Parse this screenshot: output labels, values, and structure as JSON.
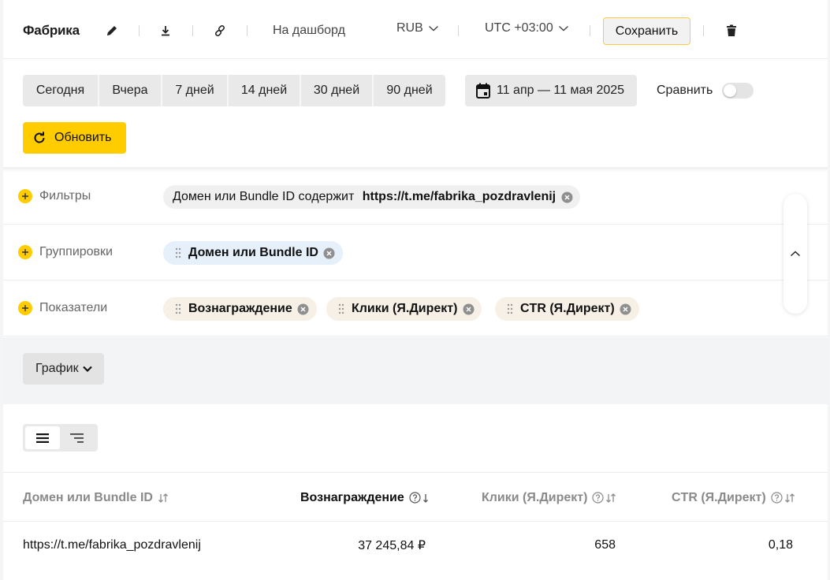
{
  "header": {
    "title": "Фабрика",
    "dashboard_link": "На дашборд",
    "currency": "RUB",
    "timezone": "UTC +03:00",
    "save_label": "Сохранить"
  },
  "periods": [
    "Сегодня",
    "Вчера",
    "7 дней",
    "14 дней",
    "30 дней",
    "90 дней"
  ],
  "date_range": "11 апр — 11 мая 2025",
  "compare_label": "Сравнить",
  "compare_enabled": false,
  "refresh_label": "Обновить",
  "filters": {
    "label": "Фильтры",
    "chip_prefix": "Домен или Bundle ID содержит ",
    "chip_value": "https://t.me/fabrika_pozdravlenij"
  },
  "groupings": {
    "label": "Группировки",
    "chips": [
      "Домен или Bundle ID"
    ]
  },
  "metrics": {
    "label": "Показатели",
    "chips": [
      "Вознаграждение",
      "Клики (Я.Директ)",
      "CTR (Я.Директ)"
    ]
  },
  "chart_selector": "График",
  "table": {
    "columns": [
      "Домен или Bundle ID",
      "Вознаграждение",
      "Клики (Я.Директ)",
      "CTR (Я.Директ)"
    ],
    "rows": [
      [
        "https://t.me/fabrika_pozdravlenij",
        "37 245,84 ₽",
        "658",
        "0,18"
      ]
    ]
  },
  "colors": {
    "accent": "#ffcc00",
    "save_border": "#ffc93c"
  }
}
